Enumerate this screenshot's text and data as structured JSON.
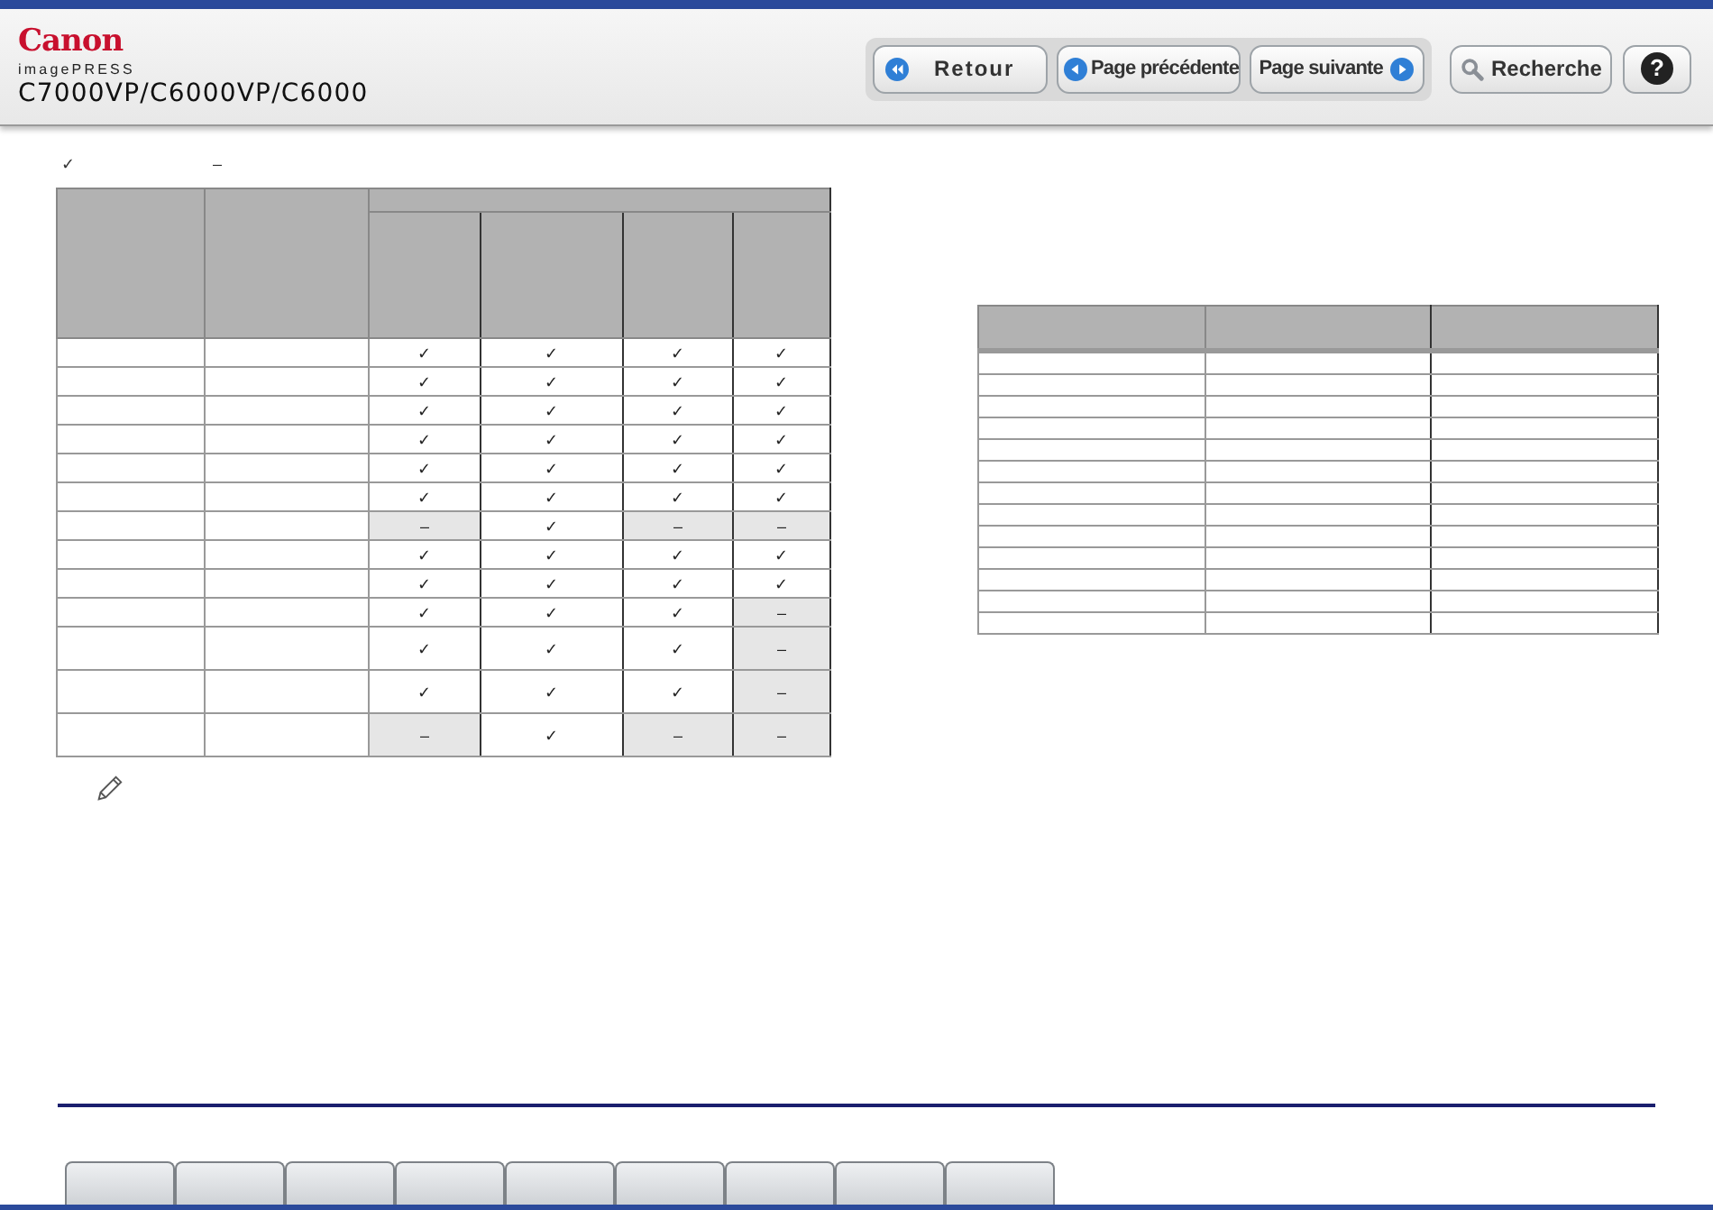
{
  "header": {
    "brand": "Canon",
    "product_line": "imagePRESS",
    "model": "C7000VP/C6000VP/C6000"
  },
  "toolbar": [
    {
      "kind": "back",
      "label": "Retour"
    },
    {
      "kind": "prev",
      "label": "Page précédente"
    },
    {
      "kind": "next",
      "label": "Page suivante"
    },
    {
      "kind": "search",
      "label": "Recherche"
    },
    {
      "kind": "help",
      "label": "?"
    }
  ],
  "legend": [
    "✓",
    "–"
  ],
  "left_table": {
    "rows": [
      {
        "tall": false,
        "cells": [
          {
            "mark": "✓",
            "available": true
          },
          {
            "mark": "✓",
            "available": true
          },
          {
            "mark": "✓",
            "available": true
          },
          {
            "mark": "✓",
            "available": true
          }
        ]
      },
      {
        "tall": false,
        "cells": [
          {
            "mark": "✓",
            "available": true
          },
          {
            "mark": "✓",
            "available": true
          },
          {
            "mark": "✓",
            "available": true
          },
          {
            "mark": "✓",
            "available": true
          }
        ]
      },
      {
        "tall": false,
        "cells": [
          {
            "mark": "✓",
            "available": true
          },
          {
            "mark": "✓",
            "available": true
          },
          {
            "mark": "✓",
            "available": true
          },
          {
            "mark": "✓",
            "available": true
          }
        ]
      },
      {
        "tall": false,
        "cells": [
          {
            "mark": "✓",
            "available": true
          },
          {
            "mark": "✓",
            "available": true
          },
          {
            "mark": "✓",
            "available": true
          },
          {
            "mark": "✓",
            "available": true
          }
        ]
      },
      {
        "tall": false,
        "cells": [
          {
            "mark": "✓",
            "available": true
          },
          {
            "mark": "✓",
            "available": true
          },
          {
            "mark": "✓",
            "available": true
          },
          {
            "mark": "✓",
            "available": true
          }
        ]
      },
      {
        "tall": false,
        "cells": [
          {
            "mark": "✓",
            "available": true
          },
          {
            "mark": "✓",
            "available": true
          },
          {
            "mark": "✓",
            "available": true
          },
          {
            "mark": "✓",
            "available": true
          }
        ]
      },
      {
        "tall": false,
        "cells": [
          {
            "mark": "–",
            "available": false
          },
          {
            "mark": "✓",
            "available": true
          },
          {
            "mark": "–",
            "available": false
          },
          {
            "mark": "–",
            "available": false
          }
        ]
      },
      {
        "tall": false,
        "cells": [
          {
            "mark": "✓",
            "available": true
          },
          {
            "mark": "✓",
            "available": true
          },
          {
            "mark": "✓",
            "available": true
          },
          {
            "mark": "✓",
            "available": true
          }
        ]
      },
      {
        "tall": false,
        "cells": [
          {
            "mark": "✓",
            "available": true
          },
          {
            "mark": "✓",
            "available": true
          },
          {
            "mark": "✓",
            "available": true
          },
          {
            "mark": "✓",
            "available": true
          }
        ]
      },
      {
        "tall": false,
        "cells": [
          {
            "mark": "✓",
            "available": true
          },
          {
            "mark": "✓",
            "available": true
          },
          {
            "mark": "✓",
            "available": true
          },
          {
            "mark": "–",
            "available": false
          }
        ]
      },
      {
        "tall": true,
        "cells": [
          {
            "mark": "✓",
            "available": true
          },
          {
            "mark": "✓",
            "available": true
          },
          {
            "mark": "✓",
            "available": true
          },
          {
            "mark": "–",
            "available": false
          }
        ]
      },
      {
        "tall": true,
        "cells": [
          {
            "mark": "✓",
            "available": true
          },
          {
            "mark": "✓",
            "available": true
          },
          {
            "mark": "✓",
            "available": true
          },
          {
            "mark": "–",
            "available": false
          }
        ]
      },
      {
        "tall": true,
        "cells": [
          {
            "mark": "–",
            "available": false
          },
          {
            "mark": "✓",
            "available": true
          },
          {
            "mark": "–",
            "available": false
          },
          {
            "mark": "–",
            "available": false
          }
        ]
      }
    ]
  },
  "bottom_tabs": [
    {
      "kind": "tab"
    },
    {
      "kind": "tab"
    },
    {
      "kind": "tab"
    },
    {
      "kind": "tab"
    },
    {
      "kind": "tab"
    },
    {
      "kind": "tab"
    },
    {
      "kind": "tab"
    },
    {
      "kind": "tab"
    },
    {
      "kind": "tab"
    }
  ]
}
